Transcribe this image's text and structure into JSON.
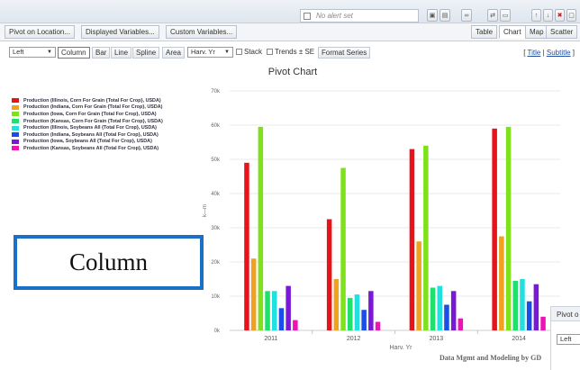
{
  "alert": {
    "label": "No alert set"
  },
  "tabs_left": [
    "Pivot on Location...",
    "Displayed Variables...",
    "Custom Variables..."
  ],
  "tabs_right": [
    "Table",
    "Chart",
    "Map",
    "Scatter"
  ],
  "active_tab": "Chart",
  "toolbar": {
    "position_select": "Left",
    "chart_types": [
      "Column",
      "Bar",
      "Line",
      "Spline",
      "Area"
    ],
    "active_type": "Column",
    "x_select": "Harv. Yr",
    "stack_label": "Stack",
    "trends_label": "Trends ± SE",
    "format_label": "Format Series",
    "title_link": "Title",
    "subtitle_link": "Subtitle"
  },
  "chart_data": {
    "type": "bar",
    "title": "Pivot Chart",
    "xlabel": "Harv. Yr",
    "ylabel": "k—m",
    "categories": [
      "2011",
      "2012",
      "2013",
      "2014"
    ],
    "ylim": [
      0,
      70
    ],
    "yticks": [
      "0k",
      "10k",
      "20k",
      "30k",
      "40k",
      "50k",
      "60k",
      "70k"
    ],
    "grid": true,
    "legend_position": "left",
    "series": [
      {
        "name": "Production (Illinois, Corn For Grain {Total For Crop}, USDA)",
        "color": "#e8121b",
        "values": [
          49,
          32.5,
          53,
          59
        ]
      },
      {
        "name": "Production (Indiana, Corn For Grain {Total For Crop}, USDA)",
        "color": "#f0a11e",
        "values": [
          21,
          15,
          26,
          27.5
        ]
      },
      {
        "name": "Production (Iowa, Corn For Grain {Total For Crop}, USDA)",
        "color": "#7fe01c",
        "values": [
          59.5,
          47.5,
          54,
          59.5
        ]
      },
      {
        "name": "Production (Kansas, Corn For Grain {Total For Crop}, USDA)",
        "color": "#1fe06a",
        "values": [
          11.5,
          9.5,
          12.5,
          14.5
        ]
      },
      {
        "name": "Production (Illinois, Soybeans All {Total For Crop}, USDA)",
        "color": "#22e0e0",
        "values": [
          11.5,
          10.5,
          13,
          15
        ]
      },
      {
        "name": "Production (Indiana, Soybeans All {Total For Crop}, USDA)",
        "color": "#1a4ee8",
        "values": [
          6.5,
          6,
          7.5,
          8.5
        ]
      },
      {
        "name": "Production (Iowa, Soybeans All {Total For Crop}, USDA)",
        "color": "#7a18d8",
        "values": [
          13,
          11.5,
          11.5,
          13.5
        ]
      },
      {
        "name": "Production (Kansas, Soybeans All {Total For Crop}, USDA)",
        "color": "#ee12b8",
        "values": [
          3,
          2.5,
          3.5,
          4
        ]
      }
    ]
  },
  "overlay_label": "Column",
  "watermark": "Data Mgmt and Modeling by GD",
  "subpanel": {
    "header": "Pivot o",
    "select": "Left"
  }
}
